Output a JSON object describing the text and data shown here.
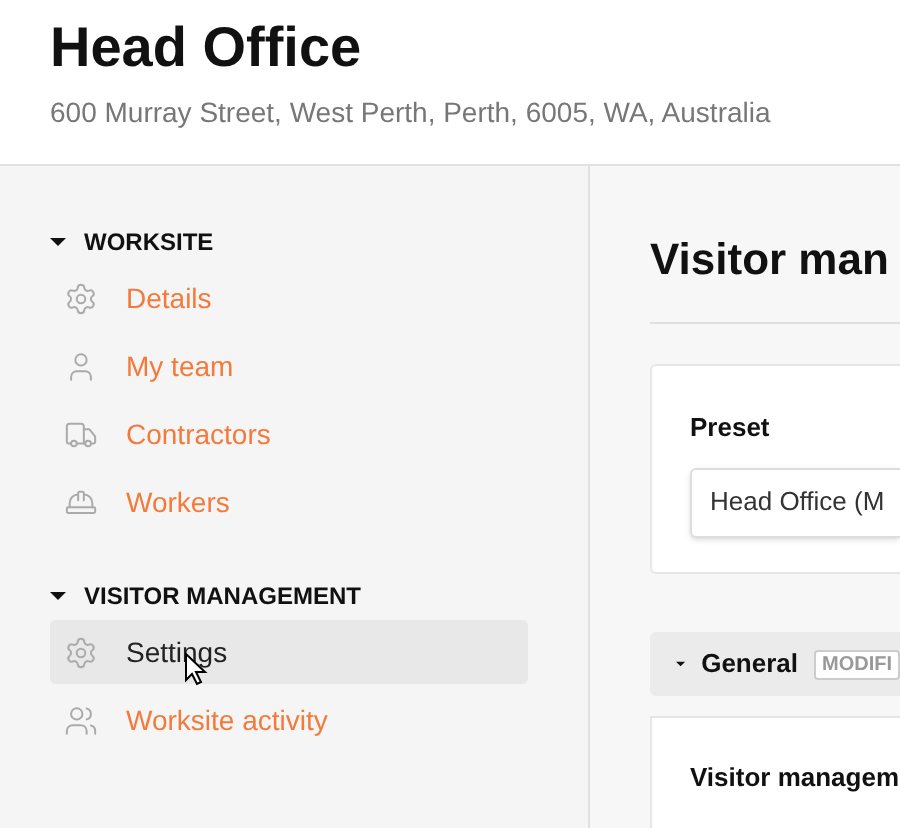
{
  "header": {
    "title": "Head Office",
    "address": "600 Murray Street, West Perth, Perth, 6005, WA, Australia"
  },
  "sidebar": {
    "sections": [
      {
        "title": "WORKSITE",
        "expanded": true,
        "items": [
          {
            "label": "Details",
            "kind": "gear",
            "selected": false
          },
          {
            "label": "My team",
            "kind": "user",
            "selected": false
          },
          {
            "label": "Contractors",
            "kind": "truck",
            "selected": false
          },
          {
            "label": "Workers",
            "kind": "worker",
            "selected": false
          }
        ]
      },
      {
        "title": "VISITOR MANAGEMENT",
        "expanded": true,
        "items": [
          {
            "label": "Settings",
            "kind": "gear",
            "selected": true
          },
          {
            "label": "Worksite activity",
            "kind": "people",
            "selected": false
          }
        ]
      }
    ]
  },
  "main": {
    "title": "Visitor man",
    "preset": {
      "label": "Preset",
      "value": "Head Office (M"
    },
    "section": {
      "title": "General",
      "badge": "MODIFI",
      "expanded": true
    },
    "card_title": "Visitor managem"
  }
}
